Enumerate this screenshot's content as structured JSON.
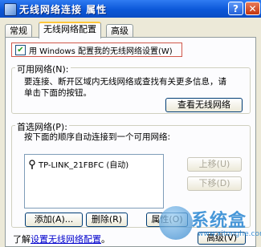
{
  "window": {
    "title": "无线网络连接  属性",
    "help_glyph": "?",
    "close_glyph": "✕"
  },
  "tabs": [
    {
      "label": "常规"
    },
    {
      "label": "无线网络配置"
    },
    {
      "label": "高级"
    }
  ],
  "active_tab": "无线网络配置",
  "windows_config": {
    "checked": true,
    "check_glyph": "✔",
    "label": "用 Windows 配置我的无线网络设置(W)"
  },
  "available": {
    "legend": "可用网络(N):",
    "description_line1": "要连接、断开区域内无线网络或查找有关更多信息，请",
    "description_line2": "单击下面的按钮。",
    "view_button": "查看无线网络"
  },
  "preferred": {
    "legend": "首选网络(P):",
    "description": "按下面的顺序自动连接到一个可用网络:",
    "networks": [
      {
        "name": "TP-LINK_21FBFC (自动)"
      }
    ],
    "move_up": "上移(U)",
    "move_down": "下移(D)",
    "add": "添加(A)...",
    "remove": "删除(R)",
    "properties": "属性(O)"
  },
  "footer": {
    "link_prefix": "了解",
    "link_text": "设置无线网络配置",
    "link_suffix": "。",
    "advanced_button": "高级(V)"
  },
  "watermark": {
    "brand": "系统盒",
    "url": "www.xitonghe.com"
  },
  "colors": {
    "titlebar": "#0b57d8",
    "dialog_bg": "#ece9d8",
    "highlight_border": "#d0574a",
    "watermark": "#1a7ecf"
  }
}
